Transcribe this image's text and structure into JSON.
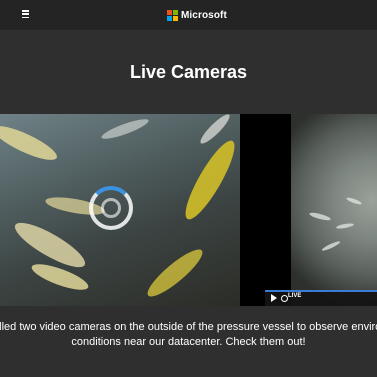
{
  "header": {
    "brand": "Microsoft",
    "menu_icon": "hamburger-icon",
    "logo_colors": [
      "#f25022",
      "#7fba00",
      "#00a4ef",
      "#ffb900"
    ]
  },
  "main": {
    "title": "Live Cameras",
    "caption_line1": "We installed two video cameras on the outside of the pressure vessel to observe environmental",
    "caption_line2": "conditions near our datacenter. Check them out!"
  },
  "player": {
    "live_label": "LIVE",
    "play_icon": "play-icon",
    "loading_icon": "loading-spinner-icon"
  }
}
